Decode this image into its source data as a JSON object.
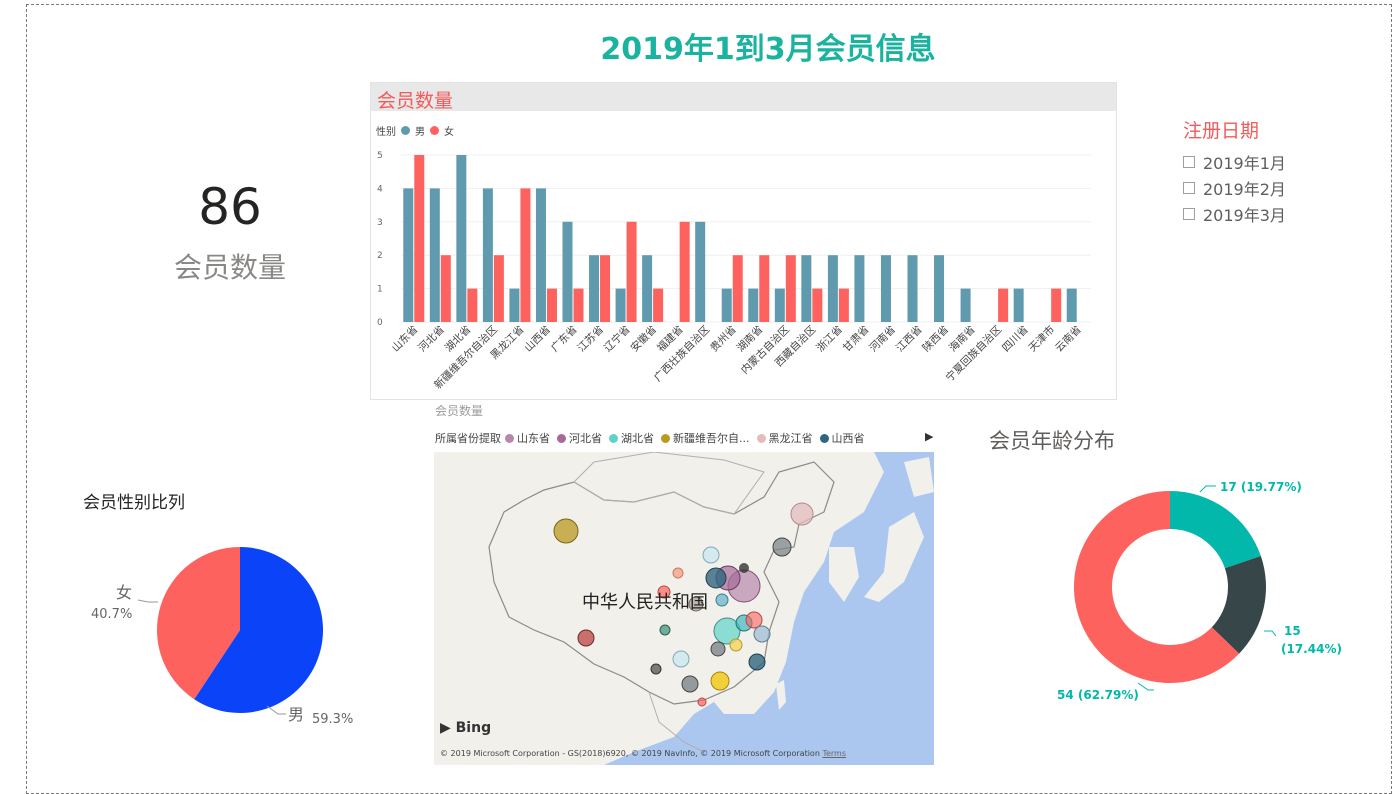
{
  "report": {
    "title": "2019年1到3月会员信息"
  },
  "kpi": {
    "value": "86",
    "label": "会员数量"
  },
  "bar_chart": {
    "header": "会员数量",
    "legend_title": "性别",
    "colors": {
      "male": "#5f9aae",
      "female": "#fd625e"
    }
  },
  "chart_data": [
    {
      "type": "bar",
      "title": "会员数量",
      "legend_title": "性别",
      "categories": [
        "山东省",
        "河北省",
        "湖北省",
        "新疆维吾尔自治区",
        "黑龙江省",
        "山西省",
        "广东省",
        "江苏省",
        "辽宁省",
        "安徽省",
        "福建省",
        "广西壮族自治区",
        "贵州省",
        "湖南省",
        "内蒙古自治区",
        "西藏自治区",
        "浙江省",
        "甘肃省",
        "河南省",
        "江西省",
        "陕西省",
        "海南省",
        "宁夏回族自治区",
        "四川省",
        "天津市",
        "云南省"
      ],
      "series": [
        {
          "name": "男",
          "values": [
            4,
            4,
            5,
            4,
            1,
            4,
            3,
            2,
            1,
            2,
            0,
            3,
            1,
            1,
            1,
            2,
            2,
            2,
            2,
            2,
            2,
            1,
            0,
            1,
            0,
            1
          ]
        },
        {
          "name": "女",
          "values": [
            5,
            2,
            1,
            2,
            4,
            1,
            1,
            2,
            3,
            1,
            3,
            0,
            2,
            2,
            2,
            1,
            1,
            0,
            0,
            0,
            0,
            0,
            1,
            0,
            1,
            0
          ]
        }
      ],
      "ylim": [
        0,
        5
      ],
      "yticks": [
        0,
        1,
        2,
        3,
        4,
        5
      ],
      "grid": true,
      "legend_position": "top-left"
    },
    {
      "type": "pie",
      "title": "会员性别比列",
      "slices": [
        {
          "label": "男",
          "value": 59.3,
          "text": "59.3%",
          "color": "#0b43f8"
        },
        {
          "label": "女",
          "value": 40.7,
          "text": "40.7%",
          "color": "#fd625e"
        }
      ]
    },
    {
      "type": "pie",
      "title": "会员年龄分布",
      "donut": true,
      "slices": [
        {
          "value": 17,
          "text": "17 (19.77%)",
          "color": "#01b8aa"
        },
        {
          "value": 15,
          "text": "15 (17.44%)",
          "color": "#374649"
        },
        {
          "value": 54,
          "text": "54 (62.79%)",
          "color": "#fd625e"
        }
      ]
    }
  ],
  "slicer": {
    "title": "注册日期",
    "items": [
      "2019年1月",
      "2019年2月",
      "2019年3月"
    ]
  },
  "map": {
    "title": "会员数量",
    "legend_title": "所属省份提取",
    "legend": [
      {
        "label": "山东省",
        "color": "#b887ad"
      },
      {
        "label": "河北省",
        "color": "#a66999"
      },
      {
        "label": "湖北省",
        "color": "#5fd3c9"
      },
      {
        "label": "新疆维吾尔自...",
        "color": "#b89a22"
      },
      {
        "label": "黑龙江省",
        "color": "#e3bcbe"
      },
      {
        "label": "山西省",
        "color": "#2f6580"
      }
    ],
    "country_label": "中华人民共和国",
    "bing": "Bing",
    "copyright": "© 2019 Microsoft Corporation - GS(2018)6920, © 2019 NavInfo, © 2019 Microsoft Corporation",
    "terms": "Terms"
  },
  "gender": {
    "title": "会员性别比列",
    "male_label": "男",
    "male_pct": "59.3%",
    "female_label": "女",
    "female_pct": "40.7%"
  },
  "age": {
    "title": "会员年龄分布",
    "labels": [
      "17 (19.77%)",
      "15",
      "(17.44%)",
      "54 (62.79%)"
    ]
  }
}
